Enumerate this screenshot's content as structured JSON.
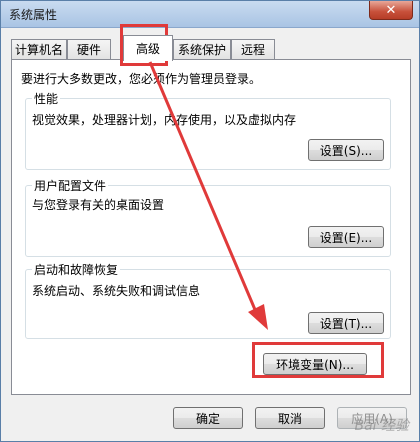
{
  "window": {
    "title": "系统属性",
    "close_glyph": "✕"
  },
  "tabs": [
    {
      "label": "计算机名"
    },
    {
      "label": "硬件"
    },
    {
      "label": "高级"
    },
    {
      "label": "系统保护"
    },
    {
      "label": "远程"
    }
  ],
  "notice": "要进行大多数更改，您必须作为管理员登录。",
  "performance": {
    "label": "性能",
    "desc": "视觉效果，处理器计划，内存使用，以及虚拟内存",
    "button": "设置(S)..."
  },
  "profiles": {
    "label": "用户配置文件",
    "desc": "与您登录有关的桌面设置",
    "button": "设置(E)..."
  },
  "startup": {
    "label": "启动和故障恢复",
    "desc": "系统启动、系统失败和调试信息",
    "button": "设置(T)..."
  },
  "env_button": "环境变量(N)...",
  "footer": {
    "ok": "确定",
    "cancel": "取消",
    "apply": "应用(A)"
  },
  "watermark": "Bai 经验",
  "colors": {
    "annotation": "#e03a3a"
  }
}
